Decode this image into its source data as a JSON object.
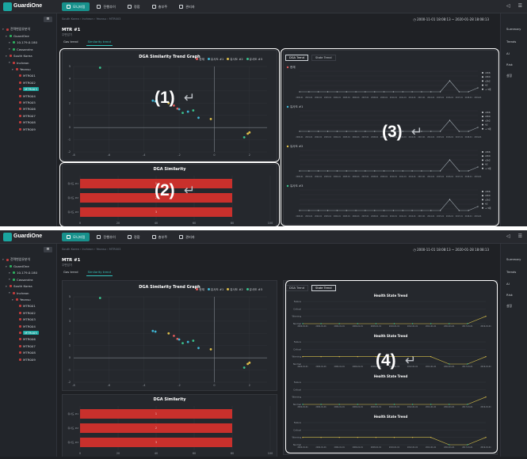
{
  "app": {
    "logo_text": "GuardiOne",
    "nav": [
      "모니터링",
      "진행추이",
      "정합",
      "충부주",
      "관리자"
    ],
    "nav_active_index": 0
  },
  "header": {
    "breadcrumb": "South Korea  ›  Incheon  ›  Yeonsu  ›  MTR003",
    "date_range": "◷  2000-11-01 18:08:13 ~ 2020-01-28 18:08:13",
    "title": "MTR #1",
    "subtitle": "주변압기"
  },
  "tabs": [
    "Gas trend",
    "Similarity trend"
  ],
  "tabs_active_index": 1,
  "tree": [
    {
      "label": "전력변압유분석",
      "level": 0,
      "color": "red"
    },
    {
      "label": "GuardOne",
      "level": 1,
      "color": "green"
    },
    {
      "label": "10.179.0.180",
      "level": 2,
      "color": "green"
    },
    {
      "label": "Cassandra",
      "level": 2,
      "color": "green"
    },
    {
      "label": "South Korea",
      "level": 1,
      "color": "red"
    },
    {
      "label": "Incheon",
      "level": 2,
      "color": "red"
    },
    {
      "label": "Yeonsu",
      "level": 3,
      "color": "red"
    },
    {
      "label": "MTR001",
      "level": 4,
      "color": "red"
    },
    {
      "label": "MTR002",
      "level": 4,
      "color": "red"
    },
    {
      "label": "MTR003",
      "level": 4,
      "color": "red",
      "selected_top": true
    },
    {
      "label": "MTR004",
      "level": 4,
      "color": "red"
    },
    {
      "label": "MTR005",
      "level": 4,
      "color": "red",
      "selected_bottom": true
    },
    {
      "label": "MTR006",
      "level": 4,
      "color": "red"
    },
    {
      "label": "MTR007",
      "level": 4,
      "color": "red"
    },
    {
      "label": "MTR008",
      "level": 4,
      "color": "red"
    },
    {
      "label": "MTR009",
      "level": 4,
      "color": "red"
    }
  ],
  "right_rail": [
    "Summary",
    "Trends",
    "AI",
    "Risk",
    "설정"
  ],
  "panels": {
    "scatter_title": "DGA Similarity Trend Graph",
    "scatter_legend": [
      "현재",
      "유사도 #1",
      "유사도 #2",
      "유사도 #3"
    ],
    "similarity_title": "DGA Similarity",
    "similarity_rows": [
      "유사도 #1",
      "유사도 #2",
      "유사도 #3"
    ],
    "similarity_x_ticks": [
      "0",
      "20",
      "40",
      "60",
      "80",
      "100"
    ],
    "trend_subtabs": [
      "DGA Trend",
      "State Trend"
    ],
    "trend_blocks": [
      "현재",
      "유사도 #1",
      "유사도 #2",
      "유사도 #3"
    ],
    "gas_legend": [
      "c2h6",
      "c2h4",
      "c2h2",
      "h2",
      "+ 3개"
    ],
    "health_title": "Health State Trend",
    "health_levels": [
      "Failure",
      "Critical",
      "Warning",
      "Normal"
    ]
  },
  "annotations": [
    "(1)",
    "(2)",
    "(3)",
    "(4)"
  ],
  "colors": {
    "accent": "#17908b",
    "bar_red": "#c9302c",
    "series_current": "#e05959",
    "series_1": "#3fb7d6",
    "series_2": "#e0c04a",
    "series_3": "#39c28e"
  },
  "chart_data": [
    {
      "type": "scatter",
      "title": "DGA Similarity Trend Graph",
      "series": [
        {
          "name": "현재",
          "points": [
            [
              -2.3,
              1.8
            ],
            [
              -2.1,
              1.55
            ]
          ]
        },
        {
          "name": "유사도 #1",
          "points": [
            [
              -3.5,
              2.2
            ],
            [
              -3.35,
              2.15
            ],
            [
              -2.0,
              1.5
            ],
            [
              -1.5,
              1.3
            ],
            [
              -0.9,
              0.8
            ]
          ]
        },
        {
          "name": "유사도 #2",
          "points": [
            [
              -2.6,
              2.0
            ],
            [
              -0.2,
              0.7
            ],
            [
              1.9,
              -0.5
            ],
            [
              2.0,
              -0.4
            ]
          ]
        },
        {
          "name": "유사도 #3",
          "points": [
            [
              -6.5,
              4.9
            ],
            [
              -1.2,
              1.4
            ],
            [
              -1.8,
              1.2
            ],
            [
              1.7,
              -0.8
            ]
          ]
        }
      ],
      "xlim": [
        -8,
        3
      ],
      "ylim": [
        -2,
        5
      ],
      "x_ticks": [
        -8,
        -6,
        -4,
        -2,
        0,
        2
      ],
      "y_ticks": [
        -2,
        -1,
        0,
        1,
        2,
        3,
        4,
        5
      ],
      "legend": "top-right"
    },
    {
      "type": "bar",
      "orientation": "horizontal",
      "title": "DGA Similarity",
      "categories": [
        "유사도 #1",
        "유사도 #2",
        "유사도 #3"
      ],
      "values": [
        80,
        80,
        80
      ],
      "data_labels": [
        "1",
        "2",
        "3"
      ],
      "xlim": [
        0,
        100
      ]
    },
    {
      "type": "line",
      "title": "DGA Trend",
      "x": [
        "2000-01",
        "2001-01",
        "2002-01",
        "2003-01",
        "2004-01",
        "2005-01",
        "2006-01",
        "2007-01",
        "2008-01",
        "2009-01",
        "2010-01",
        "2011-01",
        "2012-01",
        "2013-01",
        "2014-01",
        "2015-01",
        "2016-01",
        "2017-01",
        "2018-01",
        "2019-01"
      ],
      "series": [
        {
          "name": "현재",
          "values": [
            40,
            40,
            40,
            40,
            40,
            40,
            40,
            40,
            40,
            40,
            40,
            40,
            40,
            40,
            40,
            40,
            180,
            40,
            40,
            90
          ]
        },
        {
          "name": "유사도 #1",
          "values": [
            40,
            40,
            40,
            40,
            40,
            40,
            40,
            40,
            40,
            40,
            40,
            40,
            40,
            40,
            40,
            40,
            180,
            40,
            40,
            90
          ]
        },
        {
          "name": "유사도 #2",
          "values": [
            40,
            40,
            40,
            40,
            40,
            40,
            40,
            40,
            40,
            40,
            40,
            40,
            40,
            40,
            40,
            40,
            180,
            40,
            40,
            90
          ]
        },
        {
          "name": "유사도 #3",
          "values": [
            40,
            40,
            40,
            40,
            40,
            40,
            40,
            40,
            40,
            40,
            40,
            40,
            40,
            40,
            40,
            40,
            180,
            40,
            40,
            90
          ]
        }
      ],
      "ylim": [
        0,
        300
      ]
    },
    {
      "type": "line",
      "title": "Health State Trend",
      "x": [
        "2000-01-01",
        "2002-01-01",
        "2004-01-01",
        "2006-01-01",
        "2008-01-01",
        "2010-01-01",
        "2012-01-01",
        "2014-01-01",
        "2016-01-01",
        "2017-01-01",
        "2019-01-01"
      ],
      "levels": [
        "Normal",
        "Warning",
        "Critical",
        "Failure"
      ],
      "series": [
        {
          "name": "block1",
          "values": [
            0,
            0,
            0,
            0,
            0,
            0,
            0,
            0,
            0,
            0,
            1
          ]
        },
        {
          "name": "block2",
          "values": [
            1,
            1,
            1,
            1,
            1,
            1,
            1,
            1,
            0,
            0,
            1
          ]
        },
        {
          "name": "block3",
          "values": [
            0,
            0,
            0,
            0,
            0,
            0,
            0,
            0,
            0,
            0,
            1
          ]
        },
        {
          "name": "block4",
          "values": [
            1,
            1,
            1,
            1,
            1,
            1,
            1,
            1,
            0,
            0,
            1
          ]
        }
      ]
    }
  ]
}
